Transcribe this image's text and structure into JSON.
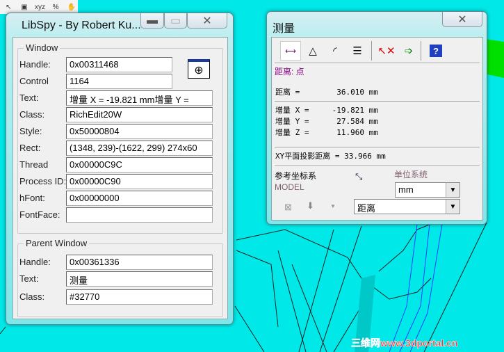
{
  "cad_toolbar": {
    "icons": [
      "select-arrow-icon",
      "box-select-icon",
      "xyz-point-icon",
      "percent-point-icon",
      "hand-icon"
    ],
    "xyz_label": "xyz"
  },
  "libspy": {
    "title": "LibSpy - By Robert Ku...",
    "window_group": {
      "legend": "Window",
      "fields": [
        {
          "label": "Handle:",
          "value": "0x00311468"
        },
        {
          "label": "Control",
          "value": "1164"
        },
        {
          "label": "Text:",
          "value": "增量 X =    -19.821 mm增量 Y ="
        },
        {
          "label": "Class:",
          "value": "RichEdit20W"
        },
        {
          "label": "Style:",
          "value": "0x50000804"
        },
        {
          "label": "Rect:",
          "value": "(1348, 239)-(1622, 299) 274x60"
        },
        {
          "label": "Thread",
          "value": "0x00000C9C"
        },
        {
          "label": "Process ID:",
          "value": "0x00000C90"
        },
        {
          "label": "hFont:",
          "value": "0x00000000"
        },
        {
          "label": "FontFace:",
          "value": ""
        }
      ]
    },
    "parent_group": {
      "legend": "Parent Window",
      "fields": [
        {
          "label": "Handle:",
          "value": "0x00361336"
        },
        {
          "label": "Text:",
          "value": "测量"
        },
        {
          "label": "Class:",
          "value": "#32770"
        }
      ]
    }
  },
  "measure": {
    "title": "测量",
    "mode": "距离: 点",
    "distance": "距离 =        36.010 mm",
    "deltas": [
      "增量 X =     -19.821 mm",
      "增量 Y =      27.584 mm",
      "增量 Z =      11.960 mm"
    ],
    "xy_projection": "XY平面投影距离 = 33.966 mm",
    "ref_coord_label": "参考坐标系",
    "ref_coord_value": "MODEL",
    "unit_label": "单位系统",
    "unit_value": "mm",
    "measure_type": "距离",
    "accent_color": "#800080"
  },
  "watermark": "三维网www.3dportal.cn"
}
